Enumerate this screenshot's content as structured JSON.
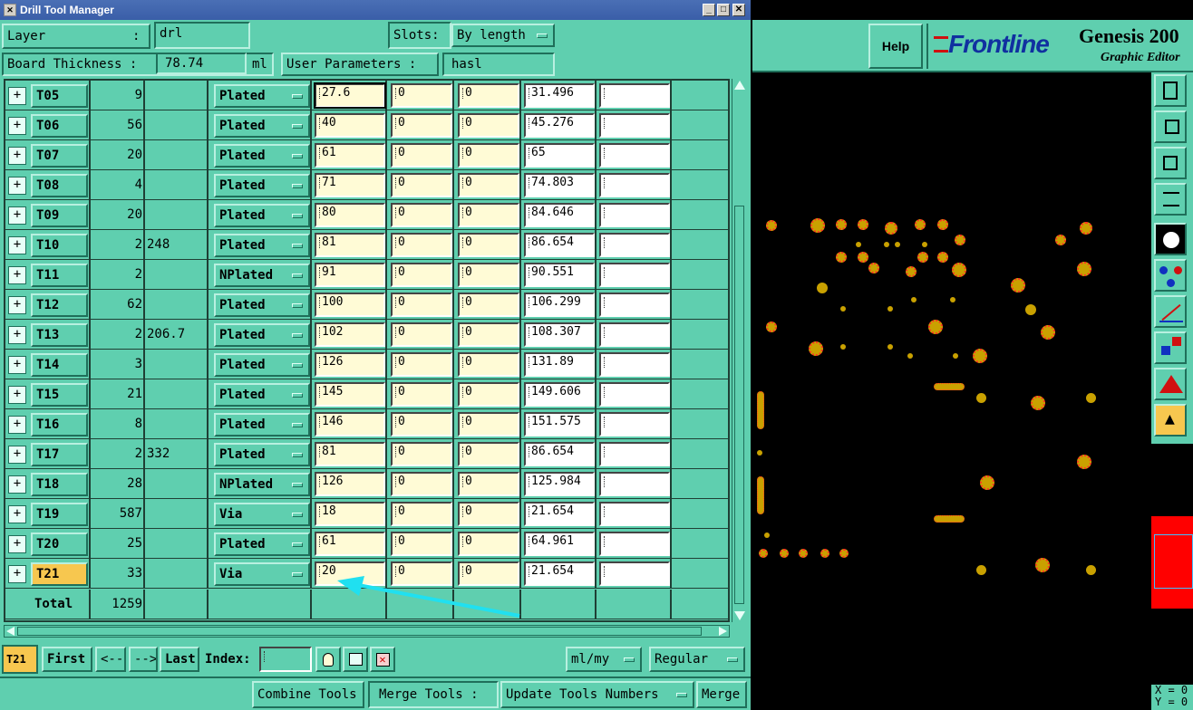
{
  "window": {
    "title": "Drill Tool Manager"
  },
  "header": {
    "layer_label": "Layer",
    "layer_colon": ":",
    "layer_value": "drl",
    "slots_label": "Slots:",
    "slots_value": "By length",
    "board_thickness_label": "Board Thickness :",
    "board_thickness_value": "78.74",
    "board_thickness_unit": "ml",
    "user_params_label": "User Parameters :",
    "user_params_value": "hasl"
  },
  "rows": [
    {
      "tool": "T05",
      "count": "9",
      "extra": "",
      "type": "Plated",
      "c1": "27.6",
      "c2": "0",
      "c3": "0",
      "c4": "31.496",
      "c5": ""
    },
    {
      "tool": "T06",
      "count": "56",
      "extra": "",
      "type": "Plated",
      "c1": "40",
      "c2": "0",
      "c3": "0",
      "c4": "45.276",
      "c5": ""
    },
    {
      "tool": "T07",
      "count": "20",
      "extra": "",
      "type": "Plated",
      "c1": "61",
      "c2": "0",
      "c3": "0",
      "c4": "65",
      "c5": ""
    },
    {
      "tool": "T08",
      "count": "4",
      "extra": "",
      "type": "Plated",
      "c1": "71",
      "c2": "0",
      "c3": "0",
      "c4": "74.803",
      "c5": ""
    },
    {
      "tool": "T09",
      "count": "20",
      "extra": "",
      "type": "Plated",
      "c1": "80",
      "c2": "0",
      "c3": "0",
      "c4": "84.646",
      "c5": ""
    },
    {
      "tool": "T10",
      "count": "2",
      "extra": "248",
      "type": "Plated",
      "c1": "81",
      "c2": "0",
      "c3": "0",
      "c4": "86.654",
      "c5": ""
    },
    {
      "tool": "T11",
      "count": "2",
      "extra": "",
      "type": "NPlated",
      "c1": "91",
      "c2": "0",
      "c3": "0",
      "c4": "90.551",
      "c5": ""
    },
    {
      "tool": "T12",
      "count": "62",
      "extra": "",
      "type": "Plated",
      "c1": "100",
      "c2": "0",
      "c3": "0",
      "c4": "106.299",
      "c5": ""
    },
    {
      "tool": "T13",
      "count": "2",
      "extra": "206.7",
      "type": "Plated",
      "c1": "102",
      "c2": "0",
      "c3": "0",
      "c4": "108.307",
      "c5": ""
    },
    {
      "tool": "T14",
      "count": "3",
      "extra": "",
      "type": "Plated",
      "c1": "126",
      "c2": "0",
      "c3": "0",
      "c4": "131.89",
      "c5": ""
    },
    {
      "tool": "T15",
      "count": "21",
      "extra": "",
      "type": "Plated",
      "c1": "145",
      "c2": "0",
      "c3": "0",
      "c4": "149.606",
      "c5": ""
    },
    {
      "tool": "T16",
      "count": "8",
      "extra": "",
      "type": "Plated",
      "c1": "146",
      "c2": "0",
      "c3": "0",
      "c4": "151.575",
      "c5": ""
    },
    {
      "tool": "T17",
      "count": "2",
      "extra": "332",
      "type": "Plated",
      "c1": "81",
      "c2": "0",
      "c3": "0",
      "c4": "86.654",
      "c5": ""
    },
    {
      "tool": "T18",
      "count": "28",
      "extra": "",
      "type": "NPlated",
      "c1": "126",
      "c2": "0",
      "c3": "0",
      "c4": "125.984",
      "c5": ""
    },
    {
      "tool": "T19",
      "count": "587",
      "extra": "",
      "type": "Via",
      "c1": "18",
      "c2": "0",
      "c3": "0",
      "c4": "21.654",
      "c5": ""
    },
    {
      "tool": "T20",
      "count": "25",
      "extra": "",
      "type": "Plated",
      "c1": "61",
      "c2": "0",
      "c3": "0",
      "c4": "64.961",
      "c5": ""
    },
    {
      "tool": "T21",
      "count": "33",
      "extra": "",
      "type": "Via",
      "c1": "20",
      "c2": "0",
      "c3": "0",
      "c4": "21.654",
      "c5": ""
    }
  ],
  "total": {
    "label": "Total",
    "value": "1259"
  },
  "bottom": {
    "current_tool": "T21",
    "first": "First",
    "prev": "<--",
    "next": "-->",
    "last": "Last",
    "index_label": "Index:",
    "units": "ml/my",
    "mode": "Regular",
    "combine": "Combine Tools",
    "merge_tools": "Merge Tools :",
    "update": "Update Tools Numbers",
    "merge": "Merge"
  },
  "editor": {
    "help": "Help",
    "brand": "Frontline",
    "product": "Genesis 200",
    "subtitle": "Graphic Editor",
    "coord_x": "X = 0",
    "coord_y": "Y = 0"
  },
  "colors": {
    "panel": "#5fcfaf",
    "field": "#fffbd6",
    "pad": "#c9a100",
    "annotation_arrow": "#20e0f0"
  }
}
